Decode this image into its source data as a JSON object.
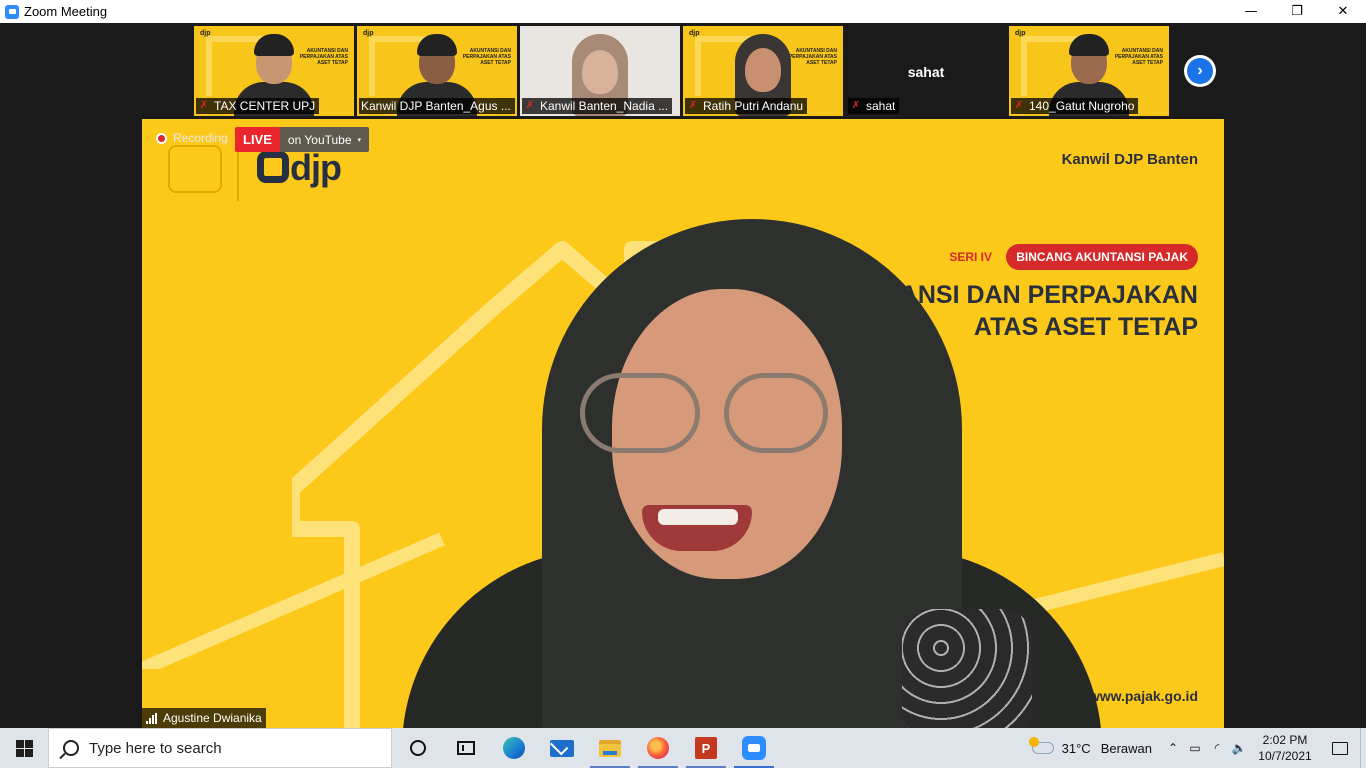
{
  "window": {
    "title": "Zoom Meeting",
    "controls": {
      "minimize": "—",
      "maximize": "❐",
      "close": "✕"
    }
  },
  "participants": [
    {
      "name": "TAX CENTER UPJ",
      "muted": true,
      "video": "background",
      "avatar": "man"
    },
    {
      "name": "Kanwil DJP Banten_Agus ...",
      "muted": true,
      "video": "background",
      "avatar": "man-headset"
    },
    {
      "name": "Kanwil Banten_Nadia ...",
      "muted": true,
      "video": "room",
      "avatar": "woman-hijab"
    },
    {
      "name": "Ratih Putri Andanu",
      "muted": true,
      "video": "background",
      "avatar": "woman-hijab"
    },
    {
      "name": "sahat",
      "muted": true,
      "video": "off",
      "display_name": "sahat"
    },
    {
      "name": "140_Gatut Nugroho",
      "muted": true,
      "video": "background",
      "avatar": "man"
    }
  ],
  "thumb_logo": "djp",
  "thumb_title": "AKUNTANSI DAN PERPAJAKAN ATAS ASET TETAP",
  "next_page_icon": "chevron-right-icon",
  "recording": {
    "label": "Recording",
    "live_label": "LIVE",
    "stream_label": "on YouTube",
    "caret": "▾"
  },
  "speaker": {
    "name": "Agustine Dwianika",
    "signal_icon": "signal-bars-icon"
  },
  "background_slide": {
    "logo_text": "djp",
    "organization": "Kanwil DJP Banten",
    "series": "SERI IV",
    "program": "BINCANG AKUNTANSI PAJAK",
    "headline_line1": "AKUNTANSI DAN PERPAJAKAN",
    "headline_line2": "ATAS ASET TETAP",
    "website": "www.pajak.go.id",
    "colors": {
      "background": "#fcc91b",
      "accent": "#d62929",
      "text": "#2a2f3c"
    }
  },
  "taskbar": {
    "search_placeholder": "Type here to search",
    "apps": [
      {
        "name": "cortana",
        "icon": "cortana-icon"
      },
      {
        "name": "task-view",
        "icon": "task-view-icon"
      },
      {
        "name": "edge",
        "icon": "edge-icon"
      },
      {
        "name": "mail",
        "icon": "mail-icon"
      },
      {
        "name": "file-explorer",
        "icon": "folder-icon"
      },
      {
        "name": "firefox",
        "icon": "firefox-icon"
      },
      {
        "name": "powerpoint",
        "icon": "powerpoint-icon",
        "letter": "P"
      },
      {
        "name": "zoom",
        "icon": "zoom-icon"
      }
    ],
    "weather": {
      "temperature": "31°C",
      "condition": "Berawan"
    },
    "tray_icons": {
      "chevron": "⌃",
      "battery": "▭",
      "network": "◜",
      "volume": "🔈"
    },
    "clock": {
      "time": "2:02 PM",
      "date": "10/7/2021"
    }
  }
}
